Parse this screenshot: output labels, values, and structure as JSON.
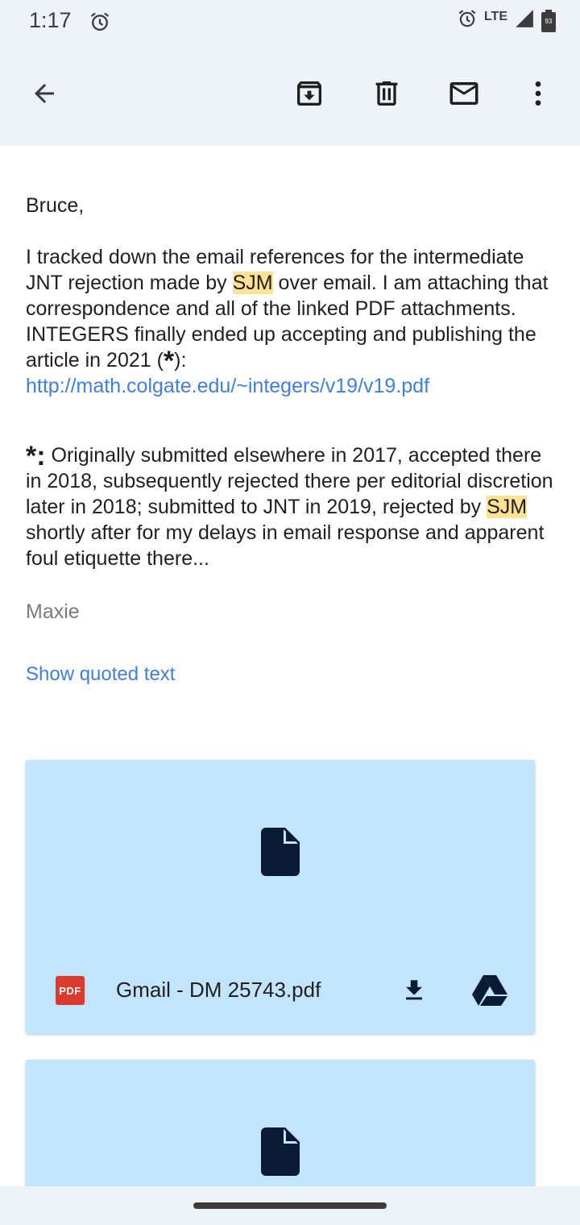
{
  "status_bar": {
    "time": "1:17",
    "network": "LTE",
    "battery_level": "93"
  },
  "toolbar": {
    "back_icon": "arrow-back-icon",
    "archive_icon": "archive-icon",
    "delete_icon": "delete-icon",
    "mark_unread_icon": "mail-icon",
    "more_icon": "more-vert-icon"
  },
  "email": {
    "greeting": "Bruce,",
    "body1_before_hl": "I tracked down the email references for the intermediate JNT rejection made by ",
    "highlight1": "SJM",
    "body1_after_hl": " over email. I am attaching that correspondence and all of the linked PDF attachments. INTEGERS finally ended up accepting and publishing the article in 2021 (",
    "star": "*",
    "body1_close": "):",
    "link": "http://math.colgate.edu/~integers/v19/v19.pdf",
    "footnote_marker": "*:",
    "body2_before_hl": " Originally submitted elsewhere in 2017, accepted there in 2018, subsequently rejected there per editorial discretion later in 2018; submitted to JNT in 2019, rejected by ",
    "highlight2": "SJM",
    "body2_after_hl": " shortly after for my delays in email response and apparent foul etiquette there...",
    "signature": "Maxie",
    "show_quoted": "Show quoted text"
  },
  "attachments": [
    {
      "type_label": "PDF",
      "name": "Gmail - DM 25743.pdf"
    }
  ],
  "colors": {
    "accent": "#3f7fdf",
    "highlight": "#fde293",
    "card": "#c2e4fc",
    "pdf_red": "#db3a2d",
    "toolbar_bg": "#eef2f9"
  }
}
